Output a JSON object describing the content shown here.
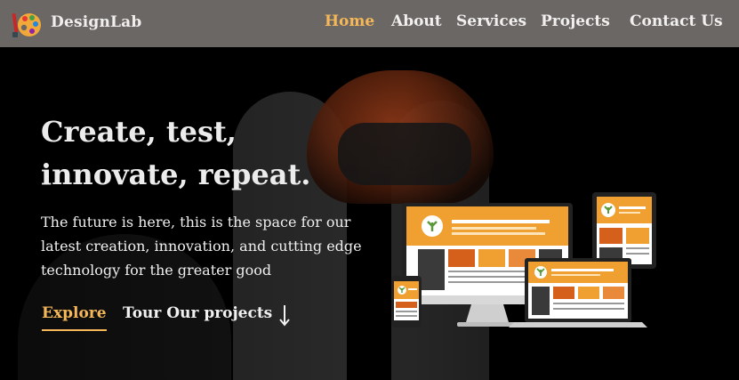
{
  "brand": {
    "name": "DesignLab"
  },
  "nav": {
    "items": [
      {
        "label": "Home",
        "active": true
      },
      {
        "label": "About",
        "active": false
      },
      {
        "label": "Services",
        "active": false
      },
      {
        "label": "Projects",
        "active": false
      },
      {
        "label": "Contact Us",
        "active": false
      }
    ]
  },
  "hero": {
    "title_line1": "Create, test,",
    "title_line2": "innovate, repeat.",
    "description": "The future is here, this is the space for our latest creation, innovation, and cutting edge technology for the greater good",
    "explore_label": "Explore",
    "tour_label": "Tour Our projects"
  },
  "icons": {
    "logo": "palette-icon",
    "tour_arrow": "arrow-down-icon",
    "illustration": "responsive-devices-illustration"
  },
  "colors": {
    "navbar_bg": "#6b6765",
    "accent": "#f5b758",
    "text": "#efefef",
    "device_orange": "#f0a030"
  }
}
